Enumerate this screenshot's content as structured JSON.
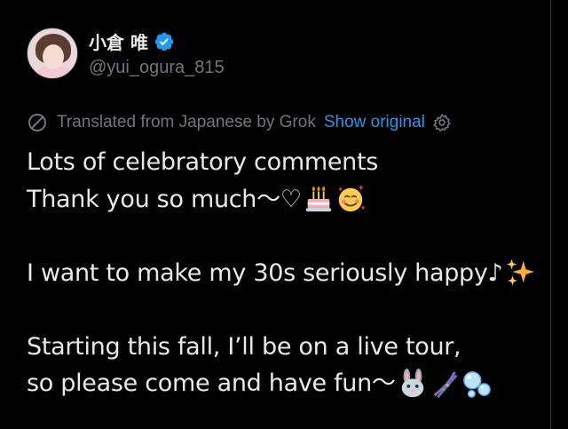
{
  "post": {
    "author": {
      "display_name": "小倉 唯",
      "handle": "@yui_ogura_815",
      "verified": true,
      "verified_color": "#1d9bf0"
    },
    "translation": {
      "label": "Translated from Japanese by Grok",
      "show_original": "Show original",
      "icons": [
        "translate-globe-icon",
        "settings-gear-icon"
      ]
    },
    "body": {
      "line1": "Lots of celebratory comments",
      "line2": "Thank you so much〜♡",
      "line2_emojis": [
        "birthday-cake-emoji",
        "smiling-face-with-hearts-emoji"
      ],
      "line3": "I want to make my 30s seriously happy♪",
      "line3_emojis": [
        "sparkles-emoji"
      ],
      "line4": "Starting this fall, I’ll be on a live tour,",
      "line5": "so please come and have fun〜",
      "line5_emojis": [
        "rabbit-face-emoji",
        "dna-emoji",
        "bubbles-emoji"
      ]
    }
  },
  "theme": {
    "background": "#000000",
    "text": "#e7e9ea",
    "muted": "#71767b",
    "link": "#1d9bf0"
  }
}
